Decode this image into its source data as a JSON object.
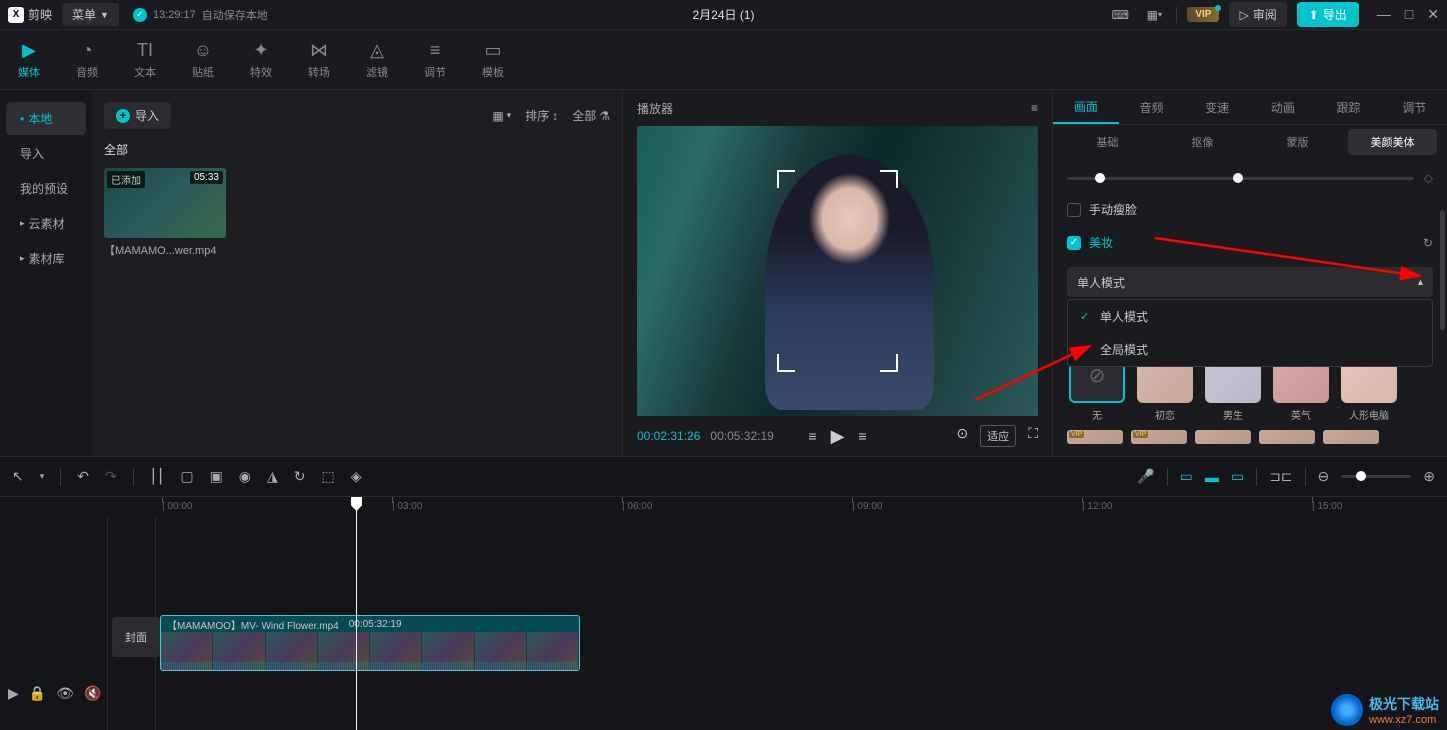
{
  "titlebar": {
    "app_name": "剪映",
    "menu": "菜单",
    "save_time": "13:29:17",
    "save_text": "自动保存本地",
    "project_title": "2月24日 (1)",
    "vip": "VIP",
    "review": "审阅",
    "export": "导出"
  },
  "toolbar": {
    "items": [
      {
        "label": "媒体",
        "icon": "▶"
      },
      {
        "label": "音频",
        "icon": "◔"
      },
      {
        "label": "文本",
        "icon": "TI"
      },
      {
        "label": "贴纸",
        "icon": "☺"
      },
      {
        "label": "特效",
        "icon": "✦"
      },
      {
        "label": "转场",
        "icon": "⋈"
      },
      {
        "label": "滤镜",
        "icon": "◬"
      },
      {
        "label": "调节",
        "icon": "⚙"
      },
      {
        "label": "模板",
        "icon": "▭"
      }
    ]
  },
  "sidebar": {
    "local": "本地",
    "import": "导入",
    "presets": "我的预设",
    "cloud": "云素材",
    "library": "素材库"
  },
  "media": {
    "import_btn": "导入",
    "view_label": "",
    "sort": "排序",
    "all": "全部",
    "tab_all": "全部",
    "clip": {
      "added": "已添加",
      "duration": "05:33",
      "name": "【MAMAMO...wer.mp4"
    }
  },
  "player": {
    "title": "播放器",
    "current_time": "00:02:31:26",
    "total_time": "00:05:32:19",
    "fit": "适应"
  },
  "right_panel": {
    "tabs": [
      "画面",
      "音频",
      "变速",
      "动画",
      "跟踪",
      "调节"
    ],
    "subtabs": [
      "基础",
      "抠像",
      "蒙版",
      "美颜美体"
    ],
    "manual_face": "手动瘦脸",
    "makeup": "美妆",
    "dropdown_value": "单人模式",
    "dropdown_options": [
      "单人模式",
      "全局模式"
    ],
    "presets": [
      "无",
      "初恋",
      "男生",
      "英气",
      "人形电脑"
    ]
  },
  "timeline": {
    "cover": "封面",
    "ticks": [
      "00:00",
      "03:00",
      "06:00",
      "09:00",
      "12:00",
      "15:00"
    ],
    "clip_name": "【MAMAMOO】MV- Wind Flower.mp4",
    "clip_duration": "00:05:32:19"
  },
  "watermark": {
    "name": "极光下载站",
    "url": "www.xz7.com"
  }
}
